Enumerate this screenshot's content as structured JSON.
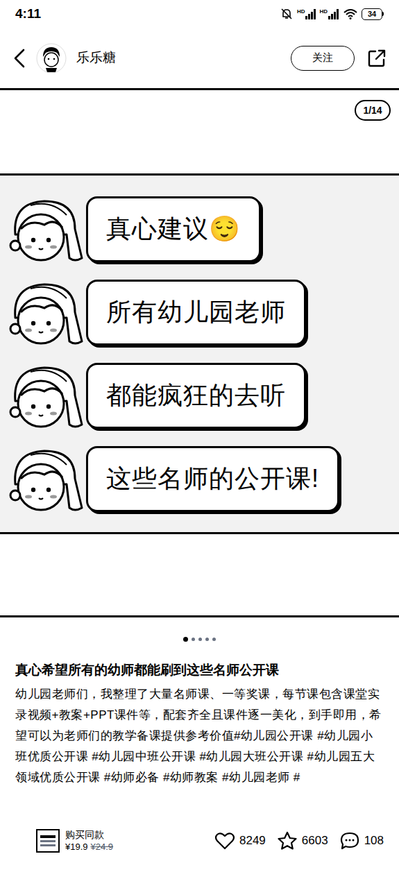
{
  "status_bar": {
    "time": "4:11",
    "signal_labels": [
      "HD",
      "HD"
    ],
    "battery": "34"
  },
  "header": {
    "author": "乐乐糖",
    "follow_button": "关注"
  },
  "image": {
    "counter": "1/14",
    "bubbles": [
      "真心建议😌",
      "所有幼儿园老师",
      "都能疯狂的去听",
      "这些名师的公开课!"
    ]
  },
  "carousel": {
    "dots": [
      {
        "selected": true
      },
      {
        "selected": false
      },
      {
        "selected": false
      },
      {
        "selected": false
      },
      {
        "selected": false
      }
    ]
  },
  "post": {
    "title": "真心希望所有的幼师都能刷到这些名师公开课",
    "body": "幼儿园老师们，我整理了大量名师课、一等奖课，每节课包含课堂实录视频+教案+PPT课件等，配套齐全且课件逐一美化，到手即用，希望可以为老师们的教学备课提供参考价值#幼儿园公开课 #幼儿园小班优质公开课 #幼儿园中班公开课 #幼儿园大班公开课 #幼儿园五大领域优质公开课 #幼师必备 #幼师教案 #幼儿园老师 #"
  },
  "bottom_bar": {
    "buy_label": "购买同款",
    "price": "¥19.9",
    "original_price": "¥24.9",
    "likes": "8249",
    "collects": "6603",
    "comments": "108"
  }
}
